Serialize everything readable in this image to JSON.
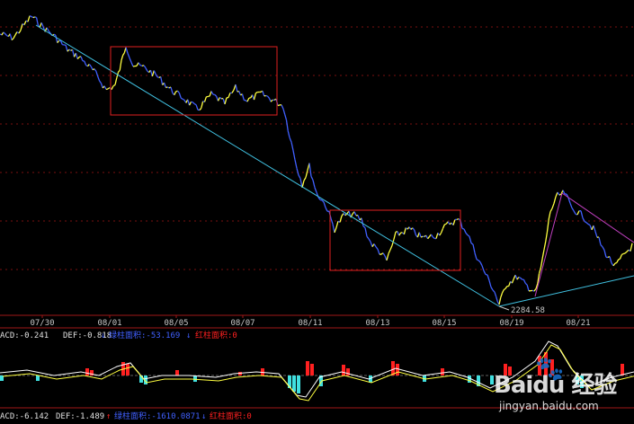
{
  "chart_data": {
    "type": "line",
    "main_panel": {
      "series_name": "",
      "x_tick_labels": [
        "07/30",
        "08/01",
        "08/05",
        "08/07",
        "08/11",
        "08/13",
        "08/15",
        "08/19",
        "08/21"
      ],
      "low_annotation": "2284.58",
      "trend_lines": [
        "down-trend",
        "up-trend",
        "resistance"
      ],
      "highlight_boxes": 2,
      "grid": true
    },
    "indicator_1": {
      "label_macd": "ACD:-0.241",
      "label_dif": "DEF:-0.818",
      "label_green": "绿柱面积:-53.169",
      "label_red": "红柱面积:0"
    },
    "indicator_2": {
      "label_macd": "ACD:-6.142",
      "label_dif": "DEF:-1.489",
      "label_green": "绿柱面积:-1610.0871",
      "label_red": "红柱面积:0"
    }
  },
  "watermark": {
    "logo": "Baidu 经验",
    "url": "jingyan.baidu.com"
  },
  "colors": {
    "background": "#000000",
    "price_up": "#ffff40",
    "price_down": "#4060ff",
    "trend_line": "#40c0e0",
    "box": "#ff2020",
    "resistance": "#c040c0",
    "grid": "#8a1010",
    "macd_white": "#ffffff",
    "macd_yellow": "#ffff40",
    "red_bar": "#ff2020",
    "green_bar": "#40e0e0"
  }
}
